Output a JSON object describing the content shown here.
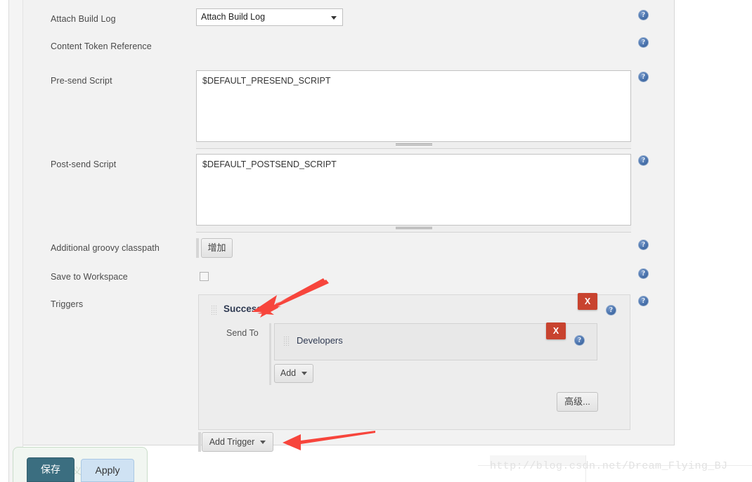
{
  "form": {
    "rows": [
      {
        "label": "Attach Build Log"
      },
      {
        "label": "Content Token Reference"
      },
      {
        "label": "Pre-send Script"
      },
      {
        "label": "Post-send Script"
      },
      {
        "label": "Additional groovy classpath"
      },
      {
        "label": "Save to Workspace"
      },
      {
        "label": "Triggers"
      }
    ],
    "attach_build_log": {
      "selected": "Attach Build Log"
    },
    "pre_send_script": {
      "value": "$DEFAULT_PRESEND_SCRIPT"
    },
    "post_send_script": {
      "value": "$DEFAULT_POSTSEND_SCRIPT"
    },
    "groovy_classpath": {
      "add_label": "增加"
    },
    "save_to_workspace": {
      "checked": false
    }
  },
  "triggers": {
    "trigger": {
      "name": "Success",
      "remove_label": "X",
      "send_to_label": "Send To",
      "recipients": [
        {
          "name": "Developers",
          "remove_label": "X"
        }
      ],
      "add_label": "Add",
      "advanced_label": "高级..."
    },
    "add_trigger_label": "Add Trigger"
  },
  "footer": {
    "save_label": "保存",
    "apply_label": "Apply",
    "ghost_label": "三义"
  },
  "watermark": {
    "text": "http://blog.csdn.net/Dream_Flying_BJ"
  },
  "icons": {
    "help": "?"
  },
  "colors": {
    "panel_bg": "#f2f2f2",
    "trigger_bg": "#ededed",
    "remove_red": "#c8432f",
    "help_blue": "#4a73ad",
    "save_teal": "#3b6e80",
    "apply_blue": "#cfe2f3",
    "annotation_red": "#f7453c"
  }
}
